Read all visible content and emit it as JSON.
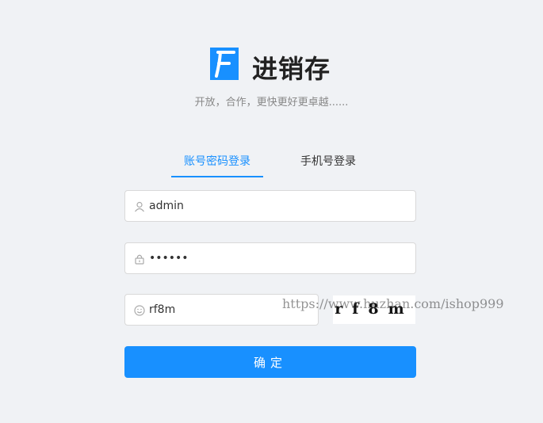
{
  "brand": {
    "title": "进销存",
    "slogan": "开放，合作，更快更好更卓越......"
  },
  "tabs": [
    {
      "label": "账号密码登录",
      "active": true
    },
    {
      "label": "手机号登录",
      "active": false
    }
  ],
  "form": {
    "username": "admin",
    "password": "••••••",
    "captcha": "rf8m",
    "captcha_image_text": "rf8m",
    "submit_label": "确定"
  },
  "watermark": "https://www.huzhan.com/ishop999",
  "colors": {
    "accent": "#1890ff",
    "background": "#f0f2f5"
  },
  "icons": {
    "logo": "F-logo",
    "username": "user-icon",
    "password": "lock-icon",
    "captcha": "smile-icon"
  }
}
